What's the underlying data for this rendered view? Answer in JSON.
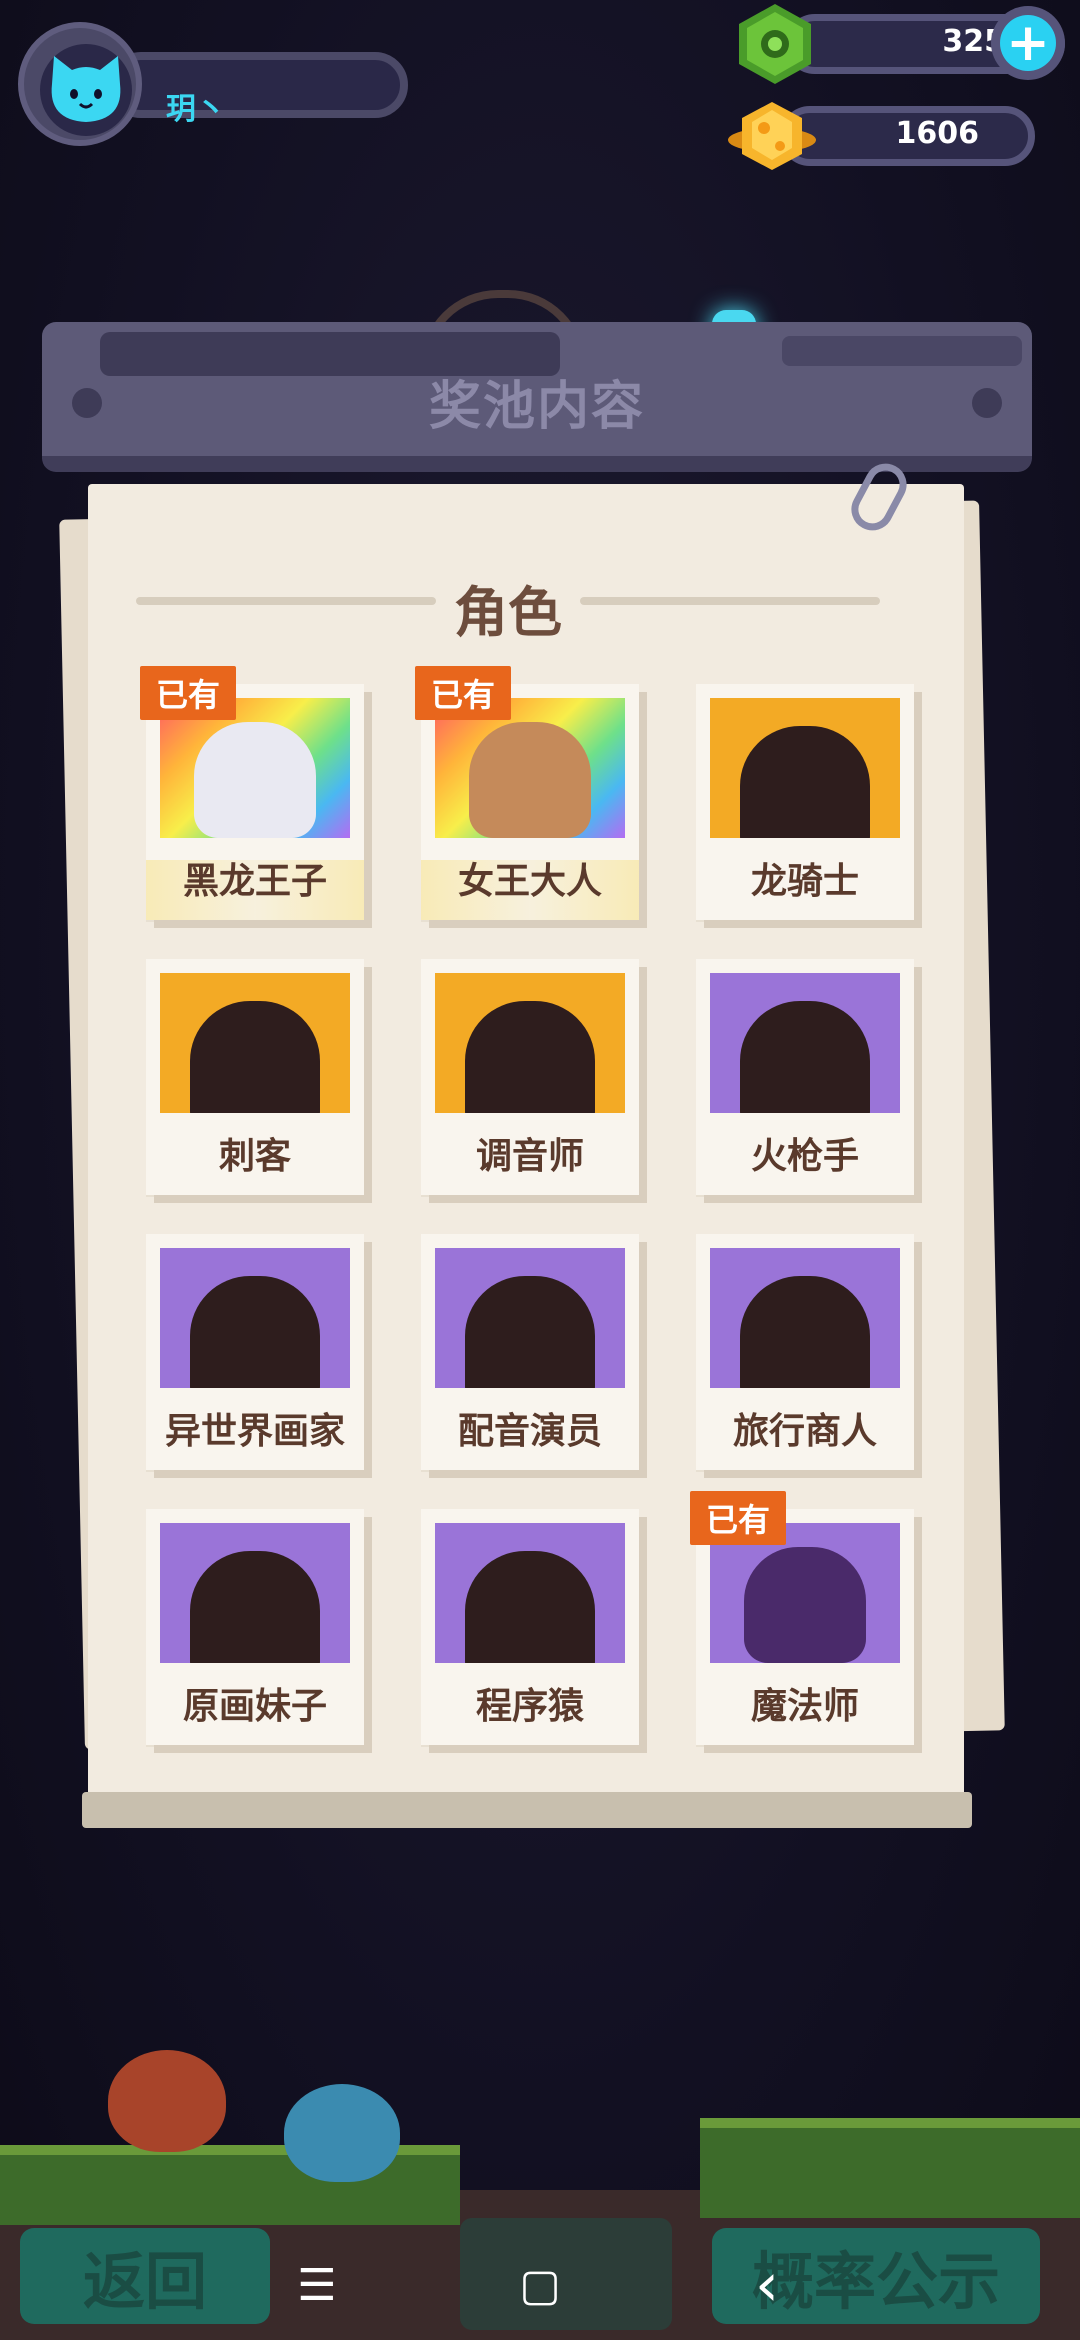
{
  "player": {
    "name": "玥丶",
    "avatar_icon": "cat-face-icon"
  },
  "currencies": [
    {
      "icon": "green-gem-icon",
      "value": "325",
      "color": "#5fbf3a"
    },
    {
      "icon": "gold-planet-icon",
      "value": "1606",
      "color": "#f7b52c"
    }
  ],
  "panel": {
    "title": "奖池内容",
    "section_title": "角色"
  },
  "owned_badge": "已有",
  "characters": [
    {
      "name": "黑龙王子",
      "owned": true,
      "rarity": "rainbow"
    },
    {
      "name": "女王大人",
      "owned": true,
      "rarity": "rainbow"
    },
    {
      "name": "龙骑士",
      "owned": false,
      "rarity": "gold"
    },
    {
      "name": "刺客",
      "owned": false,
      "rarity": "gold"
    },
    {
      "name": "调音师",
      "owned": false,
      "rarity": "gold"
    },
    {
      "name": "火枪手",
      "owned": false,
      "rarity": "purple"
    },
    {
      "name": "异世界画家",
      "owned": false,
      "rarity": "purple"
    },
    {
      "name": "配音演员",
      "owned": false,
      "rarity": "purple"
    },
    {
      "name": "旅行商人",
      "owned": false,
      "rarity": "purple"
    },
    {
      "name": "原画妹子",
      "owned": false,
      "rarity": "purple"
    },
    {
      "name": "程序猿",
      "owned": false,
      "rarity": "purple"
    },
    {
      "name": "魔法师",
      "owned": true,
      "rarity": "purple"
    }
  ],
  "buttons": {
    "back": "返回",
    "probability": "概率公示"
  },
  "system_nav": {
    "menu": "☰",
    "home": "▢",
    "back": "‹"
  }
}
